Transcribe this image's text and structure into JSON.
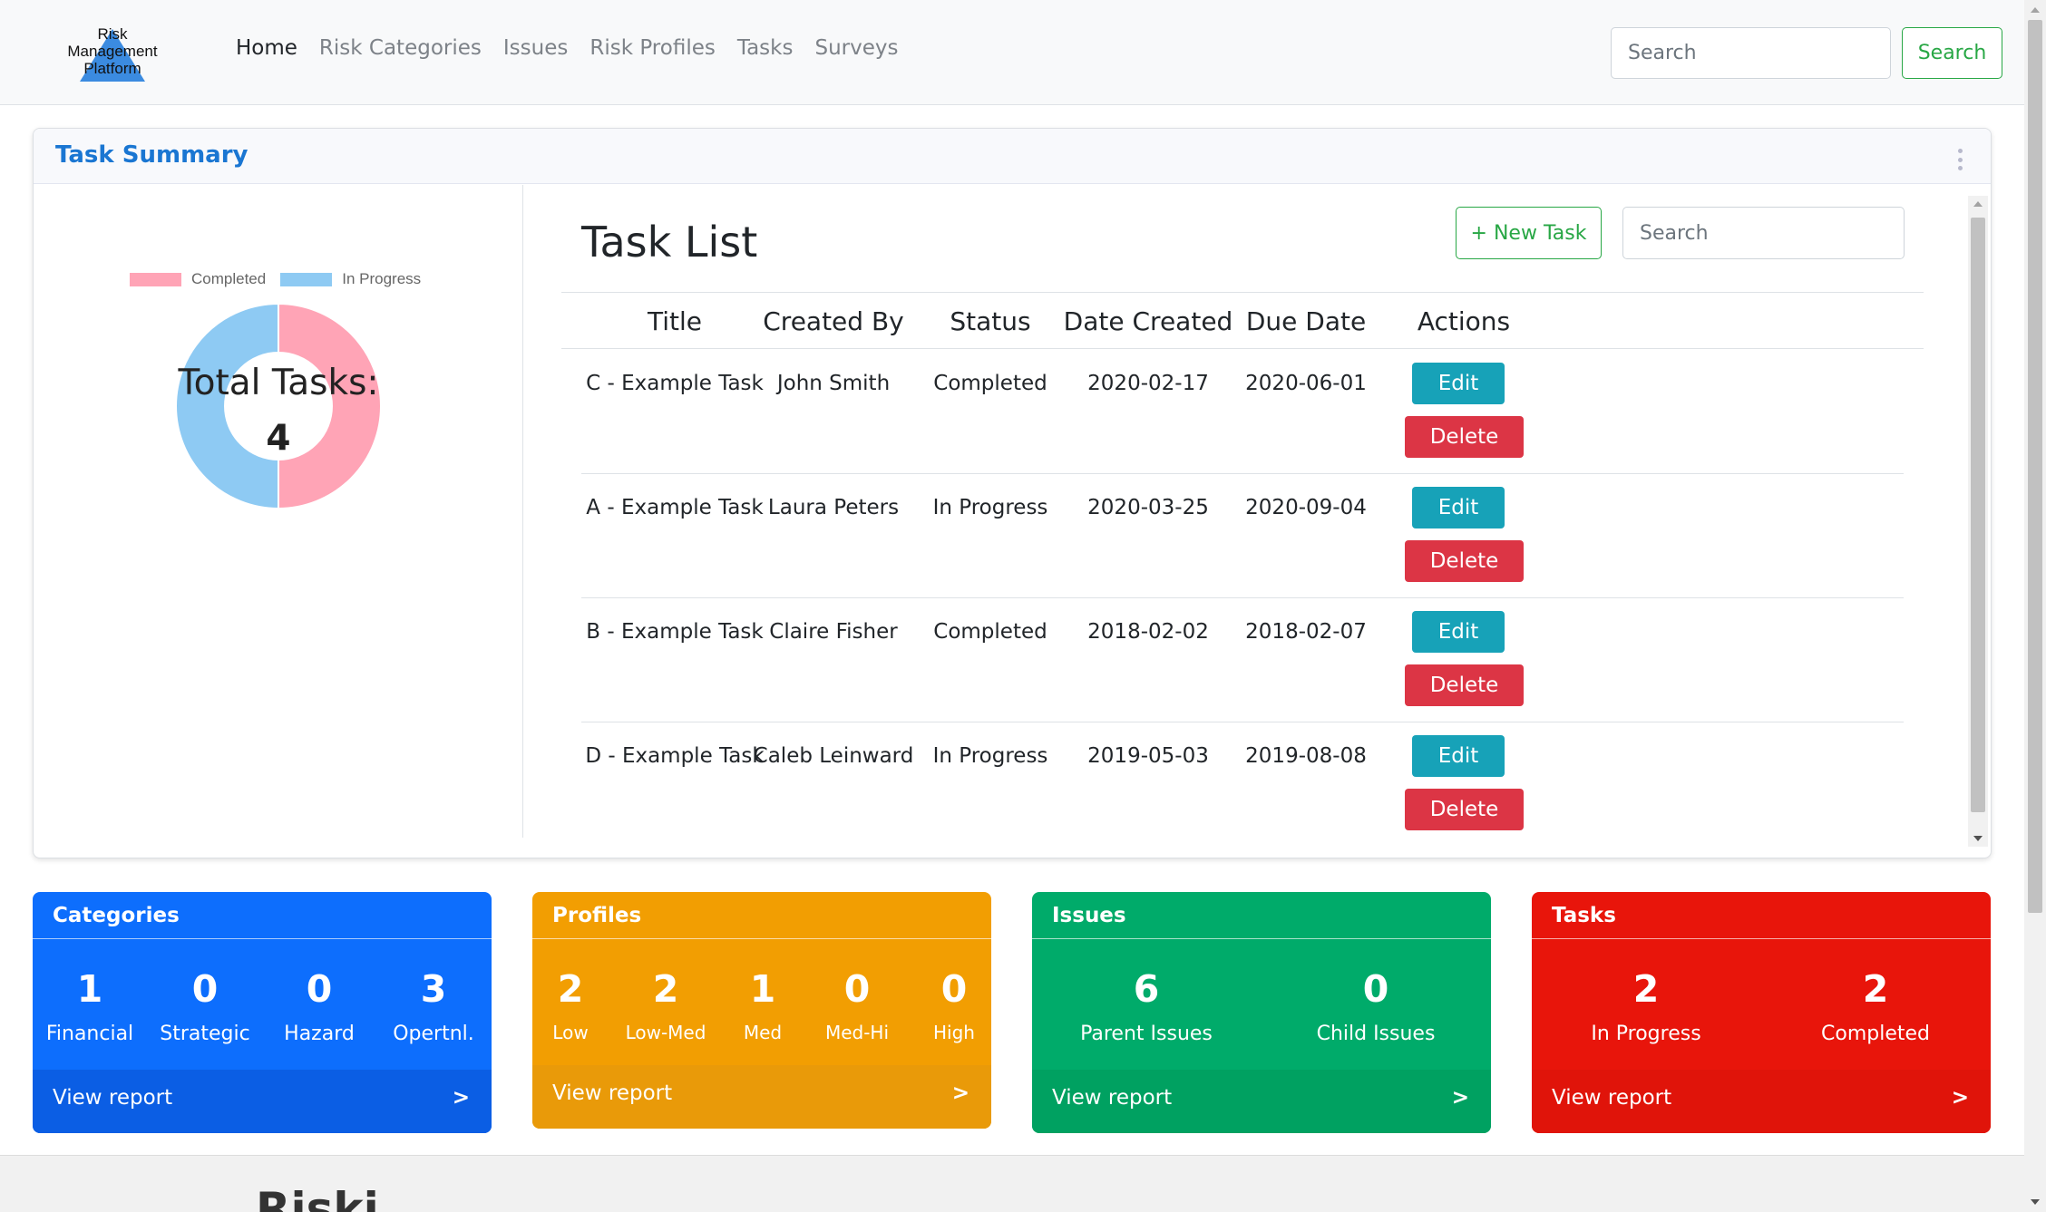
{
  "navbar": {
    "logo_text": [
      "Risk",
      "Management",
      "Platform"
    ],
    "links": [
      "Home",
      "Risk Categories",
      "Issues",
      "Risk Profiles",
      "Tasks",
      "Surveys"
    ],
    "active_link": "Home",
    "search_placeholder": "Search",
    "search_button": "Search"
  },
  "summary": {
    "title": "Task Summary",
    "chart": {
      "legend": [
        {
          "label": "Completed",
          "color": "#ffa4b6"
        },
        {
          "label": "In Progress",
          "color": "#8ecaf3"
        }
      ],
      "total_label": "Total Tasks:",
      "total_value": "4"
    },
    "task_list": {
      "title": "Task List",
      "new_task_button": "+ New Task",
      "search_placeholder": "Search",
      "columns": [
        "Title",
        "Created By",
        "Status",
        "Date Created",
        "Due Date",
        "Actions"
      ],
      "rows": [
        {
          "title": "C - Example Task",
          "created_by": "John Smith",
          "status": "Completed",
          "date_created": "2020-02-17",
          "due_date": "2020-06-01"
        },
        {
          "title": "A - Example Task",
          "created_by": "Laura Peters",
          "status": "In Progress",
          "date_created": "2020-03-25",
          "due_date": "2020-09-04"
        },
        {
          "title": "B - Example Task",
          "created_by": "Claire Fisher",
          "status": "Completed",
          "date_created": "2018-02-02",
          "due_date": "2018-02-07"
        },
        {
          "title": "D - Example Task",
          "created_by": "Caleb Leinward",
          "status": "In Progress",
          "date_created": "2019-05-03",
          "due_date": "2019-08-08"
        }
      ],
      "edit_label": "Edit",
      "delete_label": "Delete"
    }
  },
  "chart_data": {
    "type": "pie",
    "categories": [
      "Completed",
      "In Progress"
    ],
    "values": [
      2,
      2
    ],
    "colors": [
      "#ffa4b6",
      "#8ecaf3"
    ],
    "legend": "top",
    "center_text": [
      "Total Tasks:",
      "4"
    ]
  },
  "stats": [
    {
      "title": "Categories",
      "color": "#0d6efd",
      "footer_color": "#0b5ee4",
      "items": [
        {
          "value": "1",
          "label": "Financial"
        },
        {
          "value": "0",
          "label": "Strategic"
        },
        {
          "value": "0",
          "label": "Hazard"
        },
        {
          "value": "3",
          "label": "Opertnl."
        }
      ],
      "footer": "View report",
      "arrow": ">"
    },
    {
      "title": "Profiles",
      "color": "#f29e02",
      "footer_color": "#e99a09",
      "items": [
        {
          "value": "2",
          "label": "Low"
        },
        {
          "value": "2",
          "label": "Low-Med"
        },
        {
          "value": "1",
          "label": "Med"
        },
        {
          "value": "0",
          "label": "Med-Hi"
        },
        {
          "value": "0",
          "label": "High"
        }
      ],
      "footer": "View report",
      "arrow": ">"
    },
    {
      "title": "Issues",
      "color": "#00ab6a",
      "footer_color": "#00a161",
      "items": [
        {
          "value": "6",
          "label": "Parent Issues"
        },
        {
          "value": "0",
          "label": "Child Issues"
        }
      ],
      "footer": "View report",
      "arrow": ">"
    },
    {
      "title": "Tasks",
      "color": "#e8150b",
      "footer_color": "#e0140a",
      "items": [
        {
          "value": "2",
          "label": "In Progress"
        },
        {
          "value": "2",
          "label": "Completed"
        }
      ],
      "footer": "View report",
      "arrow": ">"
    }
  ],
  "footer_teaser": "Riski"
}
